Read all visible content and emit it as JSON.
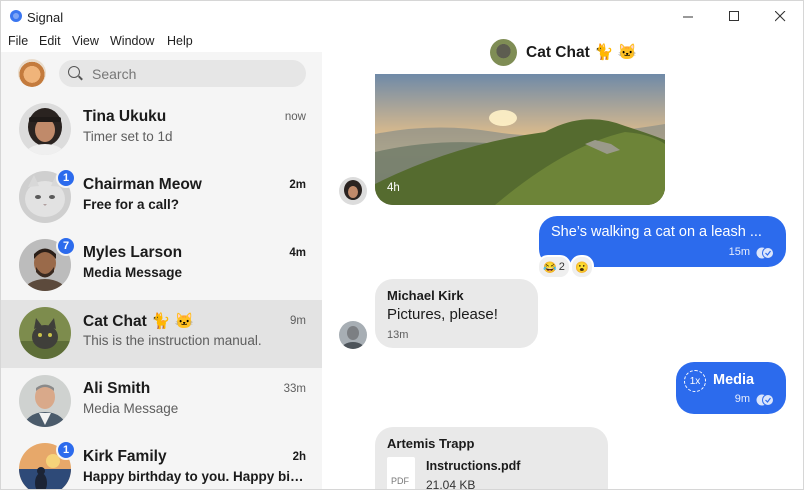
{
  "window": {
    "title": "Signal",
    "minimize": "—",
    "maximize": "☐",
    "close": "✕"
  },
  "menu": [
    "File",
    "Edit",
    "View",
    "Window",
    "Help"
  ],
  "search": {
    "placeholder": "Search"
  },
  "conversations": [
    {
      "name": "Tina Ukuku",
      "snippet": "Timer set to 1d",
      "time": "now",
      "unread": false,
      "badge": ""
    },
    {
      "name": "Chairman Meow",
      "snippet": "Free for a call?",
      "time": "2m",
      "unread": true,
      "badge": "1"
    },
    {
      "name": "Myles Larson",
      "snippet": "Media Message",
      "time": "4m",
      "unread": true,
      "badge": "7"
    },
    {
      "name": "Cat Chat 🐈 🐱",
      "snippet": "This is the instruction manual.",
      "time": "9m",
      "unread": false,
      "badge": "",
      "selected": true
    },
    {
      "name": "Ali Smith",
      "snippet": "Media Message",
      "time": "33m",
      "unread": false,
      "badge": ""
    },
    {
      "name": "Kirk Family",
      "snippet": "Happy birthday to you. Happy birthday to you",
      "time": "2h",
      "unread": true,
      "badge": "1"
    }
  ],
  "chat": {
    "title": "Cat Chat 🐈 🐱",
    "messages": {
      "photo_time": "4h",
      "out1_text": "She’s walking a cat on a leash ...",
      "out1_time": "15m",
      "reaction1_emoji": "😂",
      "reaction1_count": "2",
      "reaction2_emoji": "😮",
      "in1_sender": "Michael Kirk",
      "in1_text": "Pictures, please!",
      "in1_time": "13m",
      "out2_badge": "1x",
      "out2_text": "Media",
      "out2_time": "9m",
      "in2_sender": "Artemis Trapp",
      "in2_file_name": "Instructions.pdf",
      "in2_file_size": "21.04 KB",
      "in2_file_type": "PDF"
    }
  },
  "colors": {
    "accent": "#2c6bed",
    "sidebar": "#f5f5f5",
    "incoming_bubble": "#e9e9e9"
  }
}
